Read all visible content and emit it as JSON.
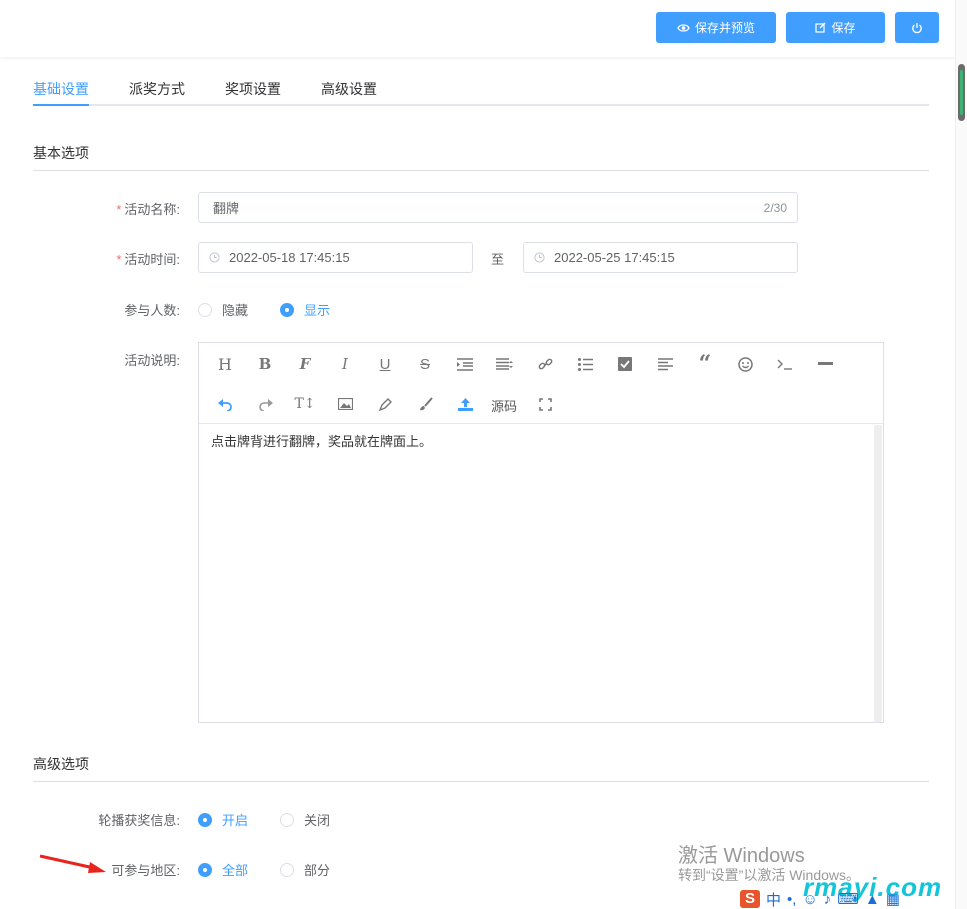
{
  "toolbar": {
    "preview_save_label": "保存并预览",
    "save_label": "保存"
  },
  "tabs": [
    "基础设置",
    "派奖方式",
    "奖项设置",
    "高级设置"
  ],
  "basic_section": {
    "title": "基本选项",
    "activity_name": {
      "label": "活动名称:",
      "value": "翻牌",
      "count": "2/30"
    },
    "activity_time": {
      "label": "活动时间:",
      "start": "2022-05-18 17:45:15",
      "separator": "至",
      "end": "2022-05-25 17:45:15"
    },
    "participants": {
      "label": "参与人数:",
      "options": [
        "隐藏",
        "显示"
      ],
      "selected": "显示"
    },
    "description": {
      "label": "活动说明:",
      "toolbar_source_label": "源码",
      "content": "点击牌背进行翻牌，奖品就在牌面上。"
    }
  },
  "advanced_section": {
    "title": "高级选项",
    "carousel": {
      "label": "轮播获奖信息:",
      "options": [
        "开启",
        "关闭"
      ],
      "selected": "开启"
    },
    "region": {
      "label": "可参与地区:",
      "options": [
        "全部",
        "部分"
      ],
      "selected": "全部"
    }
  },
  "overlay": {
    "windows_title": "激活 Windows",
    "windows_sub": "转到“设置”以激活 Windows。",
    "watermark": "rmayi.com",
    "ime_lang": "中"
  },
  "colors": {
    "accent": "#409eff",
    "required": "#f56c6c",
    "border": "#dcdfe6"
  }
}
